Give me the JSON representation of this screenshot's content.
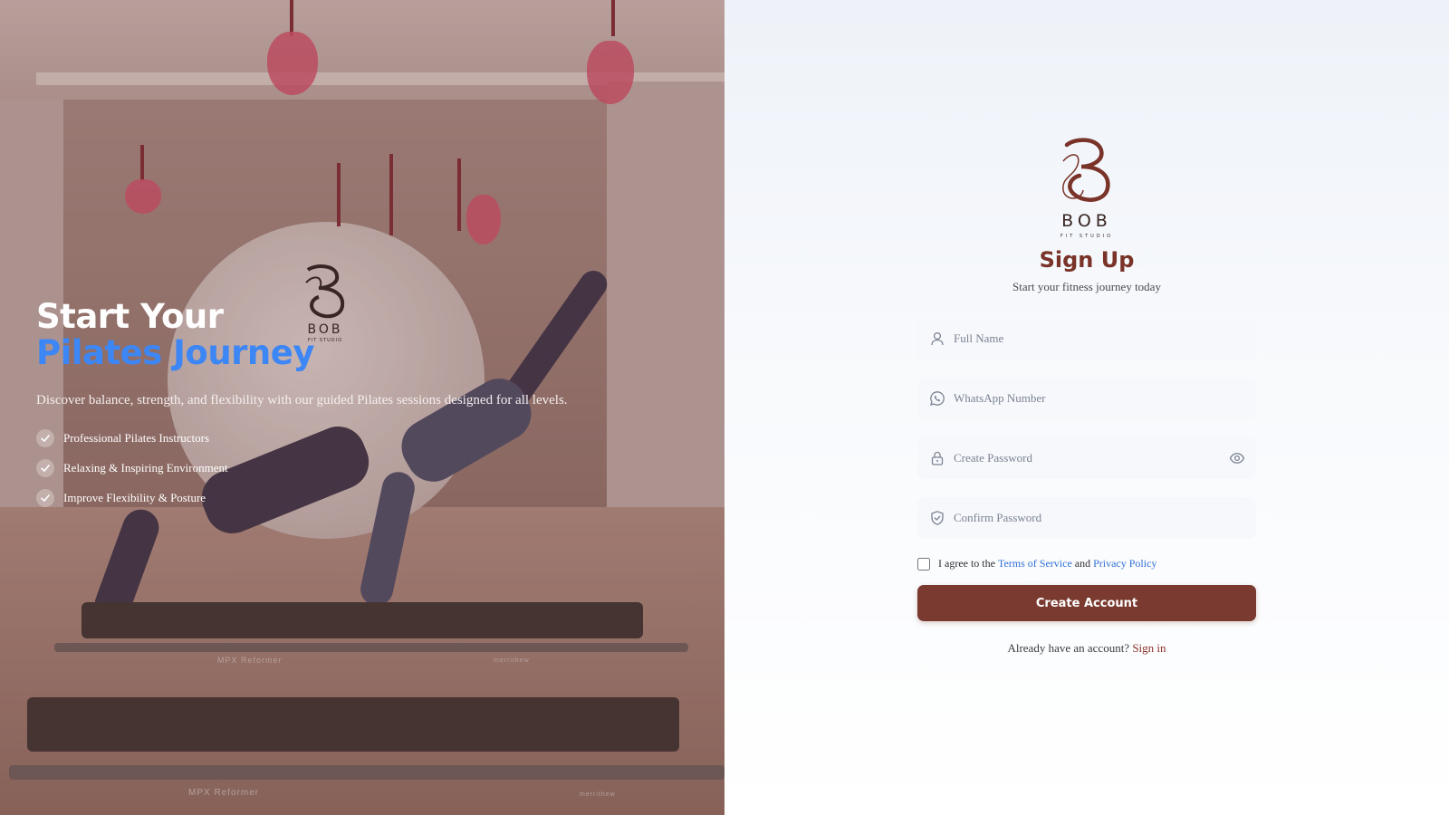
{
  "colors": {
    "accent_blue": "#3d86f5",
    "brand_brown": "#7a3a30",
    "link_blue": "#2f6fd8",
    "signin_link": "#8a2e28"
  },
  "hero": {
    "title_line1": "Start Your",
    "title_line2": "Pilates Journey",
    "description": "Discover balance, strength, and flexibility with our guided Pilates sessions designed for all levels.",
    "features": [
      "Professional Pilates Instructors",
      "Relaxing & Inspiring Environment",
      "Improve Flexibility & Posture"
    ],
    "photo_logo_text": "BOB",
    "photo_logo_subtext": "FIT STUDIO",
    "equipment_text_1": "MPX Reformer",
    "equipment_text_2": "MPX Reformer",
    "equipment_text_3": "merrithew",
    "equipment_text_4": "merrithew"
  },
  "brand": {
    "name": "BOB",
    "tagline": "FIT STUDIO"
  },
  "form": {
    "title": "Sign Up",
    "subtitle": "Start your fitness journey today",
    "full_name_placeholder": "Full Name",
    "whatsapp_placeholder": "WhatsApp Number",
    "password_placeholder": "Create Password",
    "confirm_placeholder": "Confirm Password",
    "agree_prefix": "I agree to the",
    "terms_label": "Terms of Service",
    "agree_and": "and",
    "privacy_label": "Privacy Policy",
    "submit_label": "Create Account",
    "signin_prompt": "Already have an account?",
    "signin_label": "Sign in",
    "agree_checked": false
  },
  "icons": {
    "full_name": "user-icon",
    "whatsapp": "whatsapp-icon",
    "password": "lock-icon",
    "confirm": "shield-check-icon",
    "toggle_visibility": "eye-icon",
    "feature_check": "check-circle-icon"
  }
}
